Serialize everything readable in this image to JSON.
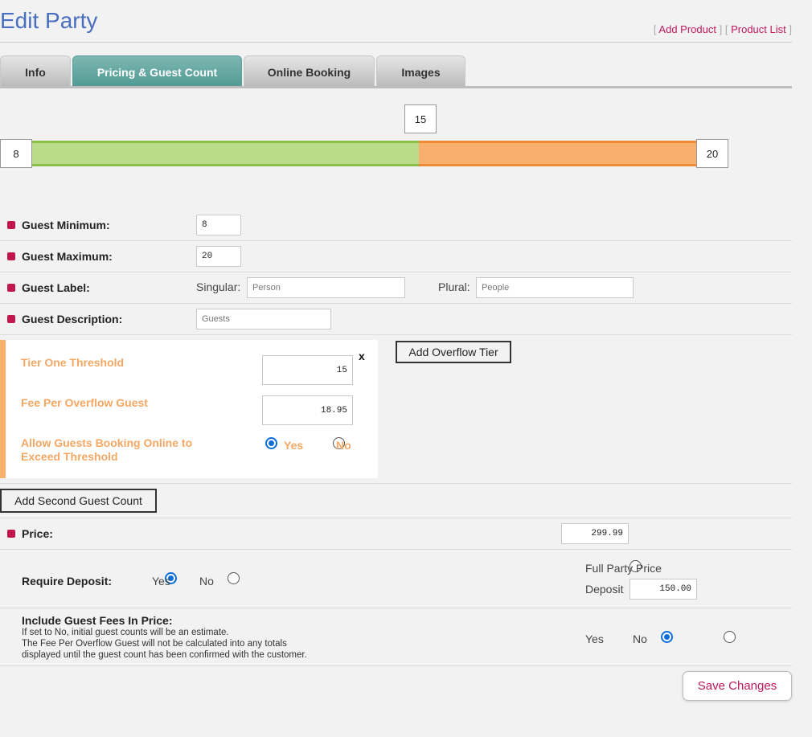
{
  "header": {
    "title": "Edit Party",
    "links": {
      "add_product": "Add Product",
      "product_list": "Product List",
      "open": "[",
      "close": "]"
    }
  },
  "tabs": [
    {
      "label": "Info",
      "active": false
    },
    {
      "label": "Pricing & Guest Count",
      "active": true
    },
    {
      "label": "Online Booking",
      "active": false
    },
    {
      "label": "Images",
      "active": false
    }
  ],
  "slider": {
    "min": "8",
    "threshold": "15",
    "max": "20"
  },
  "form": {
    "guest_minimum": {
      "label": "Guest Minimum:",
      "value": "8"
    },
    "guest_maximum": {
      "label": "Guest Maximum:",
      "value": "20"
    },
    "guest_label": {
      "label": "Guest Label:",
      "singular_label": "Singular:",
      "singular_placeholder": "Person",
      "plural_label": "Plural:",
      "plural_placeholder": "People"
    },
    "guest_description": {
      "label": "Guest Description:",
      "placeholder": "Guests"
    }
  },
  "tier": {
    "threshold_label": "Tier One Threshold",
    "threshold_value": "15",
    "fee_label": "Fee Per Overflow Guest",
    "fee_value": "18.95",
    "allow_label_line1": "Allow Guests Booking Online to",
    "allow_label_line2": "Exceed Threshold",
    "yes": "Yes",
    "no": "No",
    "remove": "x",
    "add_overflow": "Add Overflow Tier"
  },
  "add_second_guest_count": "Add Second Guest Count",
  "price": {
    "label": "Price:",
    "value": "299.99"
  },
  "deposit": {
    "label": "Require Deposit:",
    "yes": "Yes",
    "no": "No",
    "full_party_price": "Full Party Price",
    "deposit_label": "Deposit",
    "deposit_value": "150.00"
  },
  "guest_fees": {
    "label": "Include Guest Fees In Price:",
    "note_line1": "If set to No, initial guest counts will be an estimate.",
    "note_line2": "The Fee Per Overflow Guest will not be calculated into any totals",
    "note_line3": "displayed until the guest count has been confirmed with the customer.",
    "yes": "Yes",
    "no": "No"
  },
  "save_button": "Save Changes",
  "colors": {
    "title": "#4a6fbf",
    "accent": "#c0185a",
    "tab_active": "#5d9f99",
    "under": "#bcdb8a",
    "over": "#f8b06c"
  }
}
